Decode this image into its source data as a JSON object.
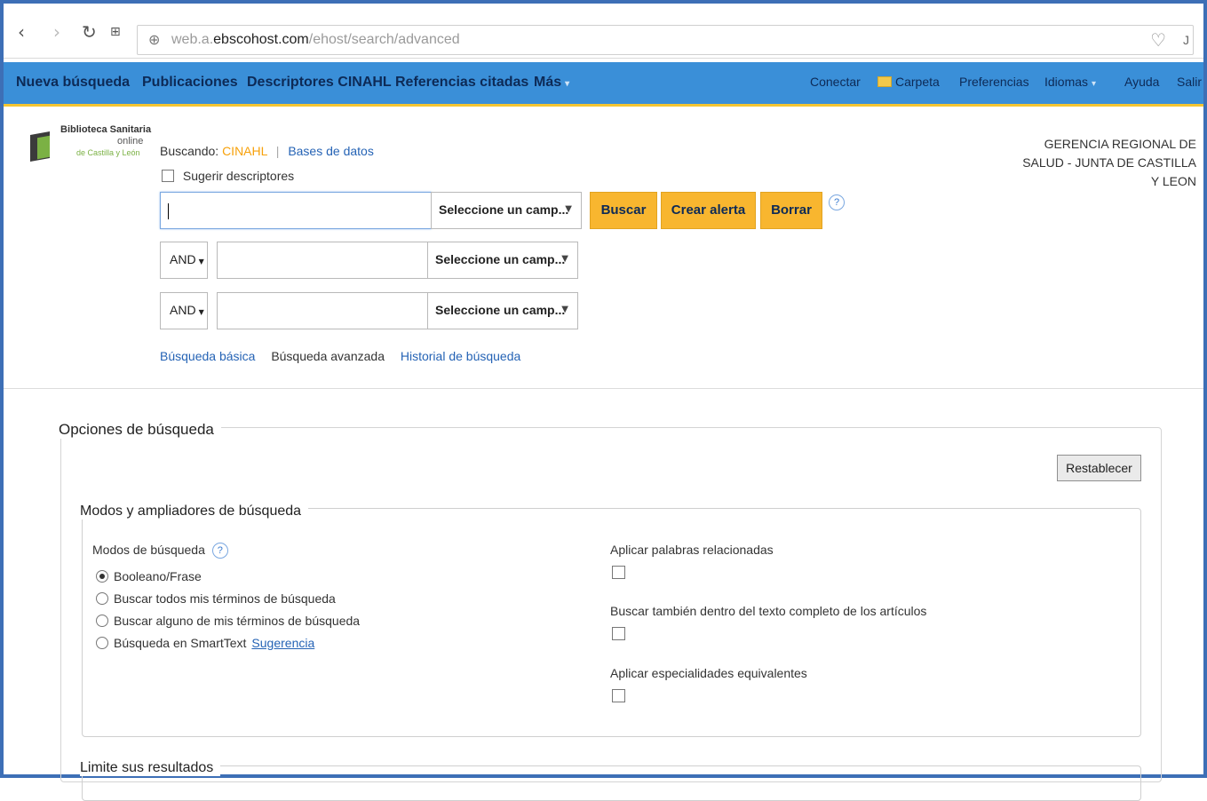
{
  "browser": {
    "url_prefix": "web.a.",
    "url_domain": "ebscohost.com",
    "url_path": "/ehost/search/advanced",
    "extra_char": "J"
  },
  "nav": {
    "left": [
      "Nueva búsqueda",
      "Publicaciones",
      "Descriptores CINAHL",
      "Referencias citadas",
      "Más"
    ],
    "right": [
      "Conectar",
      "Carpeta",
      "Preferencias",
      "Idiomas",
      "Ayuda",
      "Salir"
    ]
  },
  "logo": {
    "line1": "Biblioteca Sanitaria",
    "line2": "online",
    "line3": "de Castilla y León"
  },
  "search": {
    "searching_label": "Buscando:",
    "database": "CINAHL",
    "databases_link": "Bases de datos",
    "suggest_label": "Sugerir descriptores",
    "field_placeholder": "Seleccione un camp...",
    "bool_op": "AND",
    "buttons": {
      "search": "Buscar",
      "alert": "Crear alerta",
      "clear": "Borrar"
    },
    "help": "?",
    "links": {
      "basic": "Búsqueda básica",
      "advanced": "Búsqueda avanzada",
      "history": "Historial de búsqueda"
    }
  },
  "org": {
    "line1": "GERENCIA REGIONAL DE",
    "line2": "SALUD - JUNTA DE CASTILLA",
    "line3": "Y LEON"
  },
  "options": {
    "title": "Opciones de búsqueda",
    "reset": "Restablecer",
    "modes_section": "Modos y ampliadores de búsqueda",
    "modes_label": "Modos de búsqueda",
    "modes": [
      "Booleano/Frase",
      "Buscar todos mis términos de búsqueda",
      "Buscar alguno de mis términos de búsqueda",
      "Búsqueda en SmartText"
    ],
    "selected_mode": "Booleano/Frase",
    "suggestion_link": "Sugerencia",
    "expanders": [
      "Aplicar palabras relacionadas",
      "Buscar también dentro del texto completo de los artículos",
      "Aplicar especialidades equivalentes"
    ],
    "limit_section": "Limite sus resultados"
  }
}
